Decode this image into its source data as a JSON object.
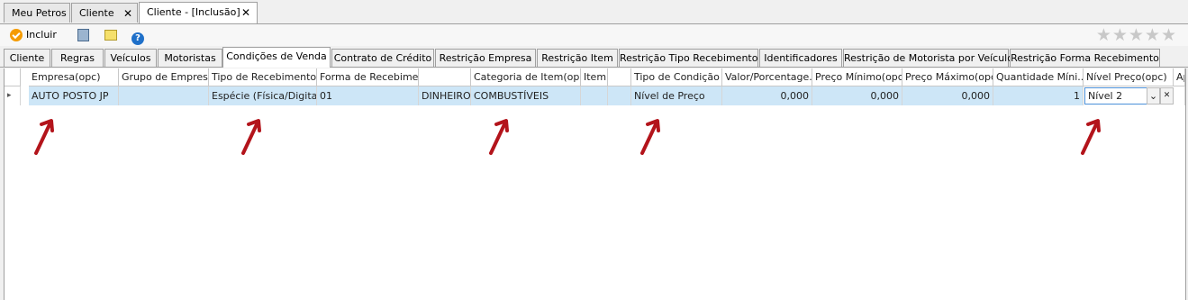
{
  "doc_tabs": [
    {
      "label": "Meu Petros"
    },
    {
      "label": "Cliente",
      "close": "✕"
    },
    {
      "label": "Cliente - [Inclusão]",
      "close": "✕"
    }
  ],
  "toolbar": {
    "incluir": "Incluir",
    "stars": "★★★★★",
    "help": "?"
  },
  "sub_tabs": [
    "Cliente",
    "Regras",
    "Veículos",
    "Motoristas",
    "Condições de Venda",
    "Contrato de Crédito",
    "Restrição Empresa",
    "Restrição Item",
    "Restrição Tipo Recebimento",
    "Identificadores",
    "Restrição de Motorista por Veículo",
    "Restrição Forma Recebimento"
  ],
  "grid": {
    "headers": [
      "Empresa(opc)",
      "Grupo de Empres...",
      "Tipo de Recebimento...",
      "Forma de Recebime...",
      "",
      "Categoria de Item(opc)",
      "Item",
      "",
      "Tipo de Condição",
      "Valor/Porcentage...",
      "Preço Mínimo(opc)",
      "Preço Máximo(opc)",
      "Quantidade Míni...",
      "Nível Preço(opc)",
      "Ap"
    ],
    "row": [
      "AUTO POSTO JP",
      "",
      "Espécie (Física/Digital)",
      "01",
      "DINHEIRO",
      "COMBUSTÍVEIS",
      "",
      "",
      "Nível de Preço",
      "0,000",
      "0,000",
      "0,000",
      "1",
      "Nível 2"
    ],
    "row_indicator": "▸",
    "dropdown_icon": "⌄",
    "clear_icon": "✕"
  },
  "colors": {
    "selected_row": "#cde6f7",
    "arrow": "#b3141b"
  }
}
